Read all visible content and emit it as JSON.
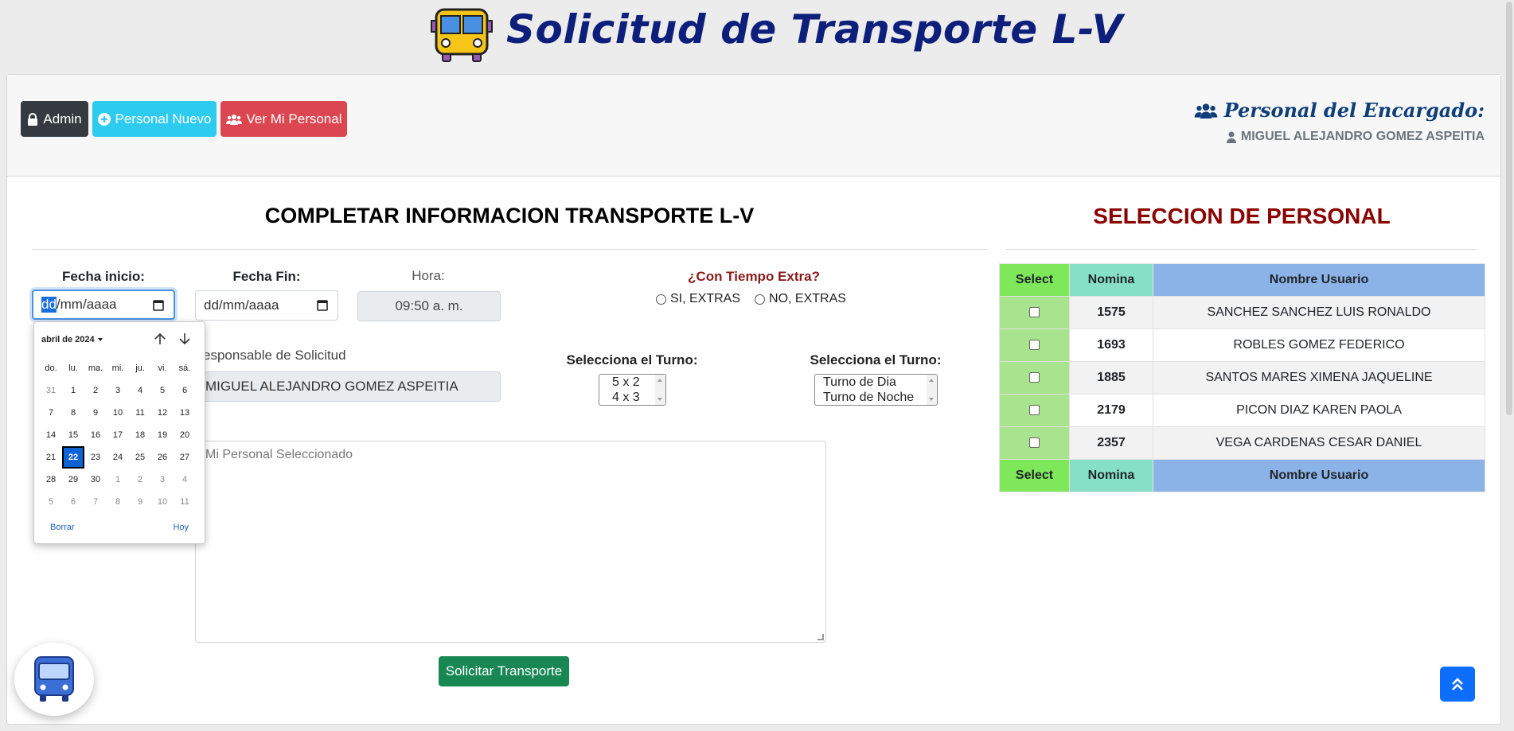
{
  "header": {
    "title": "Solicitud de Transporte L-V",
    "logo_icon": "bus-icon"
  },
  "toolbar": {
    "admin_label": "Admin",
    "new_label": "Personal Nuevo",
    "view_label": "Ver Mi Personal"
  },
  "encargado": {
    "title": "Personal del Encargado:",
    "name": "MIGUEL ALEJANDRO GOMEZ ASPEITIA"
  },
  "form": {
    "title": "COMPLETAR INFORMACION TRANSPORTE L-V",
    "fecha_inicio_label": "Fecha inicio:",
    "fecha_inicio_value": "dd/mm/aaaa",
    "fecha_inicio_day": "dd",
    "fecha_inicio_rest": "/mm/aaaa",
    "fecha_fin_label": "Fecha Fin:",
    "fecha_fin_value": "dd/mm/aaaa",
    "hora_label": "Hora:",
    "hora_value": "09:50 a. m.",
    "extra_title": "¿Con Tiempo Extra?",
    "extra_si": "SI, EXTRAS",
    "extra_no": "NO, EXTRAS",
    "responsable_label": "esponsable de Solicitud",
    "responsable_value": "MIGUEL ALEJANDRO GOMEZ ASPEITIA",
    "turno1_label": "Selecciona el Turno:",
    "turno1_options": [
      "5 x 2",
      "4 x 3"
    ],
    "turno2_label": "Selecciona el Turno:",
    "turno2_options": [
      "Turno de Dia",
      "Turno de Noche"
    ],
    "personal_placeholder": "Mi Personal Seleccionado",
    "submit_label": "Solicitar Transporte"
  },
  "datepicker": {
    "month_label": "abril de 2024",
    "dows": [
      "do.",
      "lu.",
      "ma.",
      "mi.",
      "ju.",
      "vi.",
      "sá."
    ],
    "days": [
      {
        "d": "31",
        "o": true
      },
      {
        "d": "1"
      },
      {
        "d": "2"
      },
      {
        "d": "3"
      },
      {
        "d": "4"
      },
      {
        "d": "5"
      },
      {
        "d": "6"
      },
      {
        "d": "7"
      },
      {
        "d": "8"
      },
      {
        "d": "9"
      },
      {
        "d": "10"
      },
      {
        "d": "11"
      },
      {
        "d": "12"
      },
      {
        "d": "13"
      },
      {
        "d": "14"
      },
      {
        "d": "15"
      },
      {
        "d": "16"
      },
      {
        "d": "17"
      },
      {
        "d": "18"
      },
      {
        "d": "19"
      },
      {
        "d": "20"
      },
      {
        "d": "21"
      },
      {
        "d": "22",
        "t": true
      },
      {
        "d": "23"
      },
      {
        "d": "24"
      },
      {
        "d": "25"
      },
      {
        "d": "26"
      },
      {
        "d": "27"
      },
      {
        "d": "28"
      },
      {
        "d": "29"
      },
      {
        "d": "30"
      },
      {
        "d": "1",
        "o": true
      },
      {
        "d": "2",
        "o": true
      },
      {
        "d": "3",
        "o": true
      },
      {
        "d": "4",
        "o": true
      },
      {
        "d": "5",
        "o": true
      },
      {
        "d": "6",
        "o": true
      },
      {
        "d": "7",
        "o": true
      },
      {
        "d": "8",
        "o": true
      },
      {
        "d": "9",
        "o": true
      },
      {
        "d": "10",
        "o": true
      },
      {
        "d": "11",
        "o": true
      }
    ],
    "clear_label": "Borrar",
    "today_label": "Hoy"
  },
  "seleccion": {
    "title": "SELECCION DE PERSONAL",
    "headers": [
      "Select",
      "Nomina",
      "Nombre Usuario"
    ],
    "rows": [
      {
        "nomina": "1575",
        "nombre": "SANCHEZ SANCHEZ LUIS RONALDO"
      },
      {
        "nomina": "1693",
        "nombre": "ROBLES GOMEZ FEDERICO"
      },
      {
        "nomina": "1885",
        "nombre": "SANTOS MARES XIMENA JAQUELINE"
      },
      {
        "nomina": "2179",
        "nombre": "PICON DIAZ KAREN PAOLA"
      },
      {
        "nomina": "2357",
        "nombre": "VEGA CARDENAS CESAR DANIEL"
      }
    ]
  },
  "colors": {
    "title_blue": "#0d1f7a",
    "admin_btn": "#343a40",
    "new_btn": "#2ecbf0",
    "view_btn": "#dc4651",
    "submit_btn": "#198754",
    "seleccion_title": "#8b0000"
  }
}
